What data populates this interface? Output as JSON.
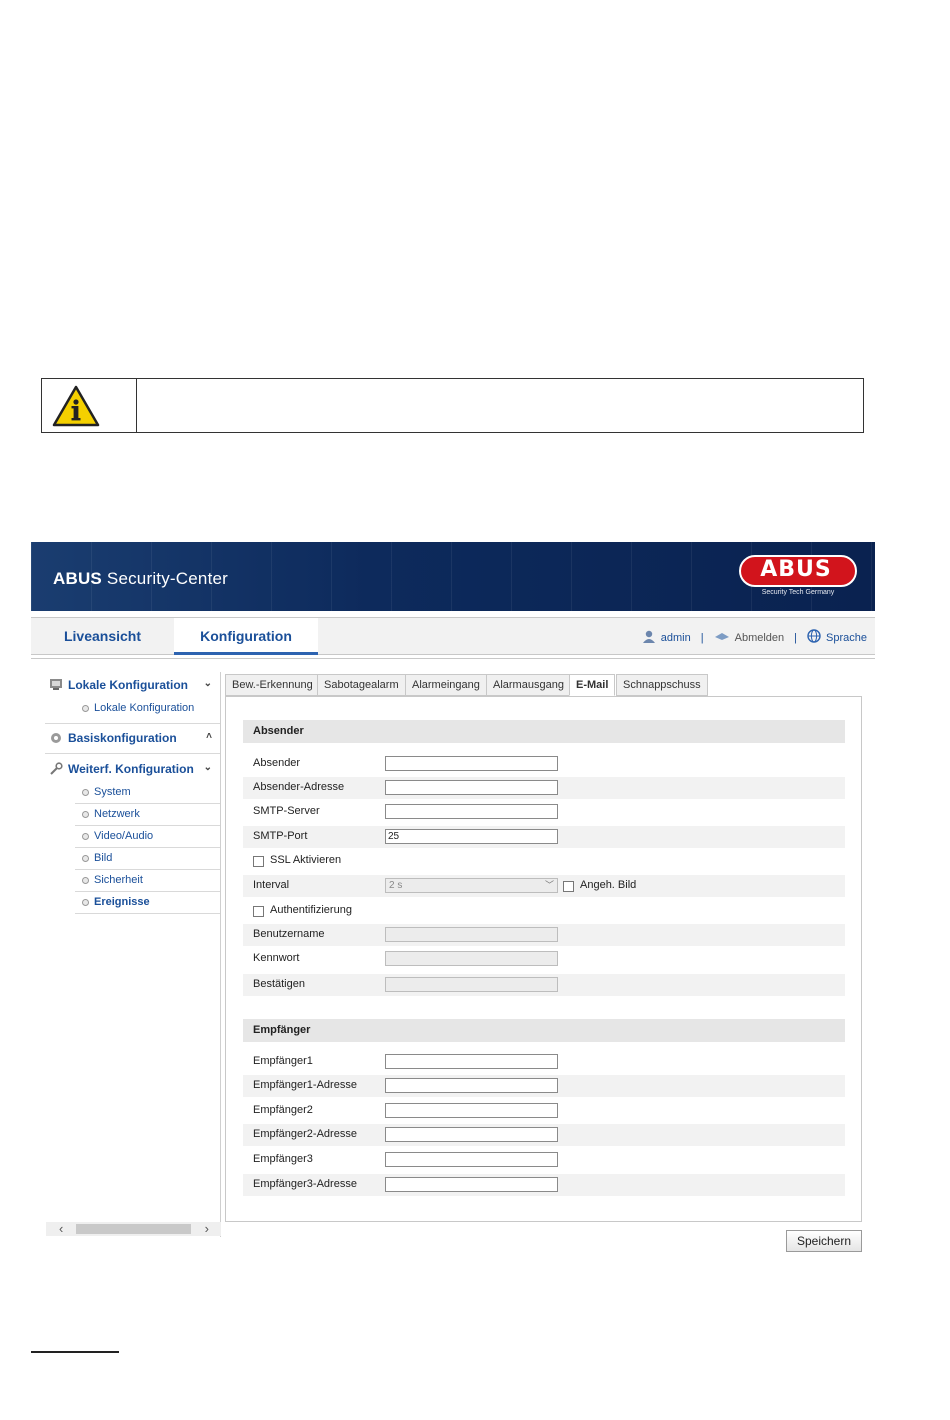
{
  "info_box": {
    "icon": "warning-info-icon"
  },
  "header": {
    "brand_bold": "ABUS",
    "brand_rest": " Security-Center",
    "logo_text": "ABUS",
    "logo_sub": "Security Tech Germany",
    "colors": {
      "header_bg": "#0d2a5c",
      "logo_red": "#d2141c",
      "link_blue": "#1a4f99"
    }
  },
  "nav": {
    "tabs": [
      {
        "label": "Liveansicht"
      },
      {
        "label": "Konfiguration",
        "active": true
      }
    ],
    "user": "admin",
    "logout": "Abmelden",
    "language": "Sprache",
    "sep1": "|",
    "sep2": "|"
  },
  "sidebar": {
    "sections": [
      {
        "label": "Lokale Konfiguration",
        "caret": "⌄",
        "items": [
          {
            "label": "Lokale Konfiguration"
          }
        ]
      },
      {
        "label": "Basiskonfiguration",
        "caret": "˄"
      },
      {
        "label": "Weiterf. Konfiguration",
        "caret": "⌄",
        "items": [
          {
            "label": "System"
          },
          {
            "label": "Netzwerk"
          },
          {
            "label": "Video/Audio"
          },
          {
            "label": "Bild"
          },
          {
            "label": "Sicherheit"
          },
          {
            "label": "Ereignisse",
            "active": true
          }
        ]
      }
    ]
  },
  "tabs": [
    {
      "label": "Bew.-Erkennung"
    },
    {
      "label": "Sabotagealarm"
    },
    {
      "label": "Alarmeingang"
    },
    {
      "label": "Alarmausgang"
    },
    {
      "label": "E-Mail",
      "active": true
    },
    {
      "label": "Schnappschuss"
    }
  ],
  "form": {
    "sender_header": "Absender",
    "sender": {
      "label": "Absender",
      "value": ""
    },
    "sender_address": {
      "label": "Absender-Adresse",
      "value": ""
    },
    "smtp_server": {
      "label": "SMTP-Server",
      "value": ""
    },
    "smtp_port": {
      "label": "SMTP-Port",
      "value": "25"
    },
    "ssl": {
      "label": "SSL Aktivieren",
      "checked": false
    },
    "interval": {
      "label": "Interval",
      "value": "2 s",
      "attach_label": "Angeh. Bild",
      "attach_checked": false
    },
    "auth": {
      "label": "Authentifizierung",
      "checked": false
    },
    "username": {
      "label": "Benutzername",
      "value": ""
    },
    "password": {
      "label": "Kennwort",
      "value": ""
    },
    "confirm": {
      "label": "Bestätigen",
      "value": ""
    },
    "recipient_header": "Empfänger",
    "recipients": [
      {
        "label": "Empfänger1",
        "value": ""
      },
      {
        "label": "Empfänger1-Adresse",
        "value": ""
      },
      {
        "label": "Empfänger2",
        "value": ""
      },
      {
        "label": "Empfänger2-Adresse",
        "value": ""
      },
      {
        "label": "Empfänger3",
        "value": ""
      },
      {
        "label": "Empfänger3-Adresse",
        "value": ""
      }
    ]
  },
  "save_button": "Speichern",
  "scroll": {
    "left": "‹",
    "right": "›"
  }
}
